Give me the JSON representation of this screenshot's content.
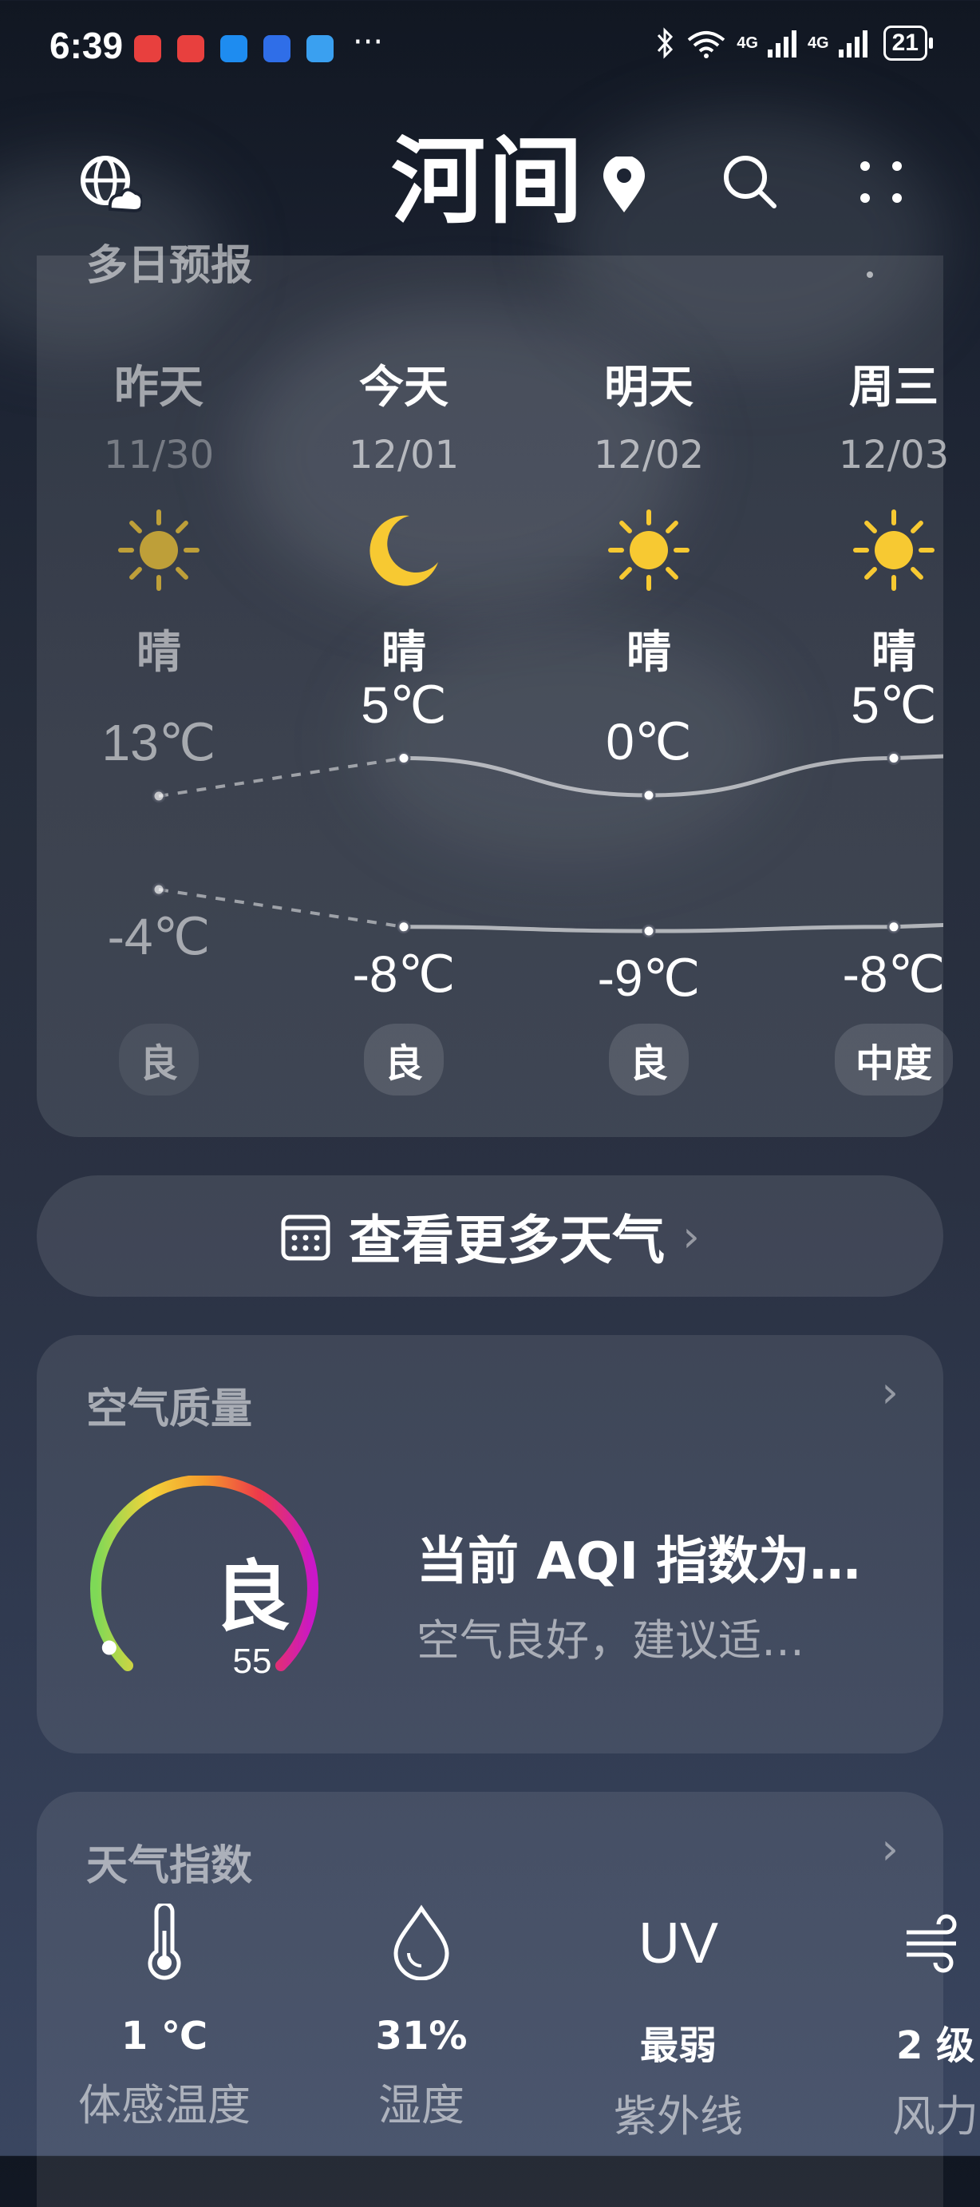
{
  "status_bar": {
    "time": "6:39",
    "more": "···",
    "network1": "4G",
    "network2": "4G",
    "battery": "21"
  },
  "header": {
    "city": "河间",
    "icons": [
      "globe-cloud-icon",
      "location-pin-icon",
      "search-icon",
      "more-icon"
    ]
  },
  "forecast": {
    "heading": "多日预报",
    "days": [
      {
        "name": "昨天",
        "date": "11/30",
        "icon": "sun-icon",
        "cond": "晴",
        "high": "13℃",
        "low": "-4℃",
        "aqi": "良",
        "past": true
      },
      {
        "name": "今天",
        "date": "12/01",
        "icon": "moon-icon",
        "cond": "晴",
        "high": "5℃",
        "low": "-8℃",
        "aqi": "良",
        "past": false
      },
      {
        "name": "明天",
        "date": "12/02",
        "icon": "sun-icon",
        "cond": "晴",
        "high": "0℃",
        "low": "-9℃",
        "aqi": "良",
        "past": false
      },
      {
        "name": "周三",
        "date": "12/03",
        "icon": "sun-icon",
        "cond": "晴",
        "high": "5℃",
        "low": "-8℃",
        "aqi": "中度",
        "past": false
      }
    ]
  },
  "more_weather": {
    "label": "查看更多天气",
    "icon": "calendar-icon"
  },
  "air_quality": {
    "heading": "空气质量",
    "level": "良",
    "aqi": "55",
    "title": "当前 AQI 指数为…",
    "desc": "空气良好，建议适…",
    "gauge_fraction": 0.06
  },
  "indices": {
    "heading": "天气指数",
    "items": [
      {
        "icon": "thermometer-icon",
        "value": "1 ℃",
        "label": "体感温度"
      },
      {
        "icon": "droplet-icon",
        "value": "31%",
        "label": "湿度"
      },
      {
        "icon": "uv-icon",
        "glyph": "UV",
        "value": "最弱",
        "label": "紫外线"
      },
      {
        "icon": "wind-icon",
        "value": "2 级",
        "label": "风力"
      }
    ]
  }
}
